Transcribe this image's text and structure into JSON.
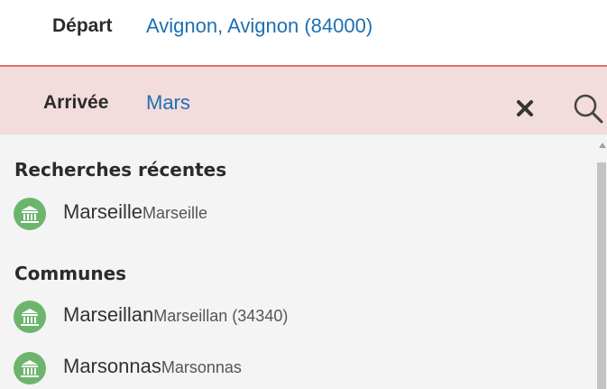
{
  "depart": {
    "label": "Départ",
    "value": "Avignon, Avignon (84000)"
  },
  "arrivee": {
    "label": "Arrivée",
    "value": "Mars"
  },
  "icons": {
    "clear": "close-icon",
    "search": "search-icon",
    "commune": "town-hall-icon"
  },
  "colors": {
    "accent_blue": "#1f6fb2",
    "error_border": "#e7706d",
    "error_bg": "#f2dcdc",
    "icon_green": "#6db56d"
  },
  "recent": {
    "title": "Recherches récentes",
    "items": [
      {
        "name": "Marseille",
        "detail": "Marseille"
      }
    ]
  },
  "communes": {
    "title": "Communes",
    "items": [
      {
        "name": "Marseillan",
        "detail": "Marseillan (34340)"
      },
      {
        "name": "Marsonnas",
        "detail": "Marsonnas"
      }
    ]
  }
}
